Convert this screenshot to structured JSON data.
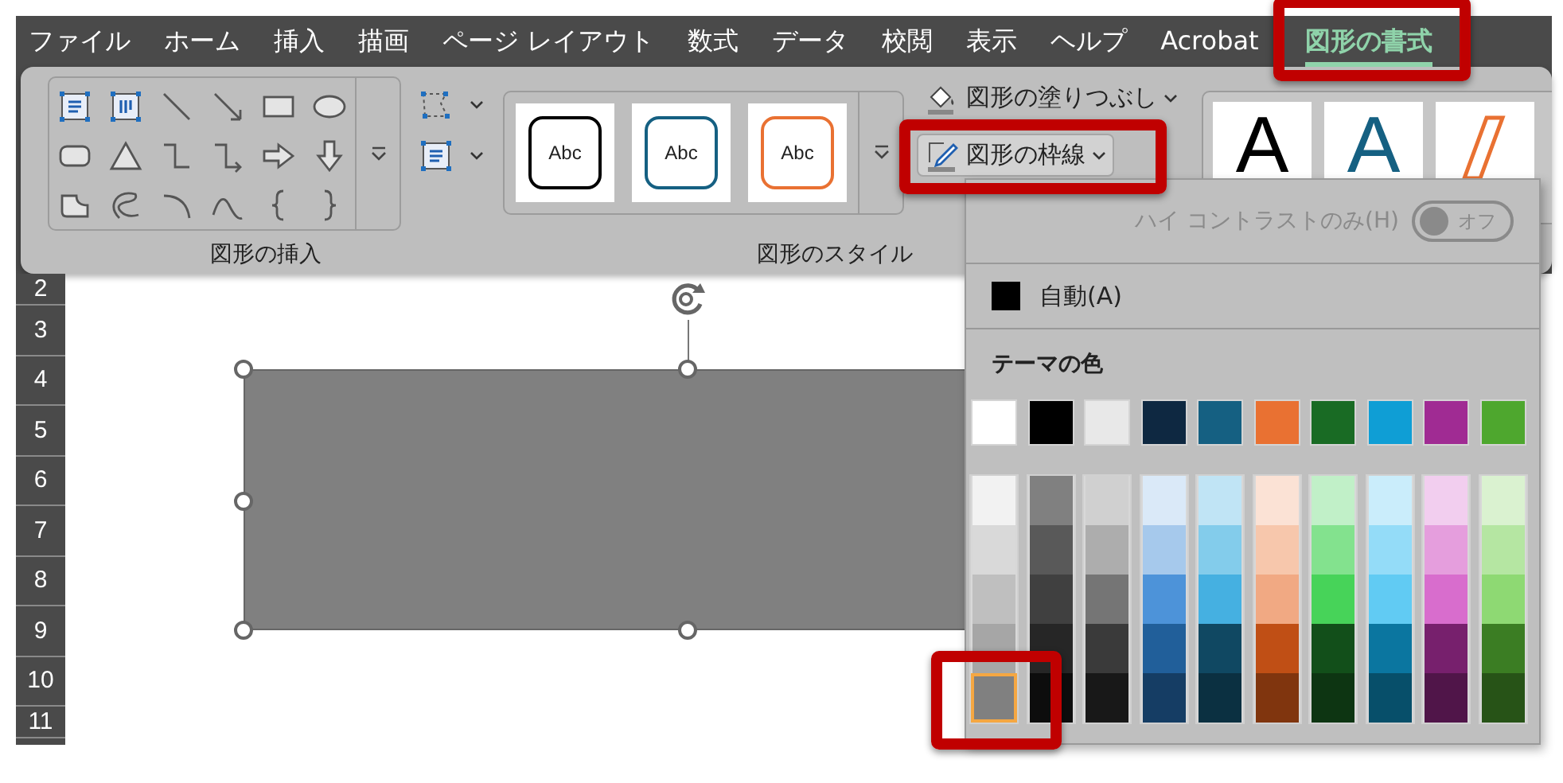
{
  "tabs": [
    {
      "label": "ファイル",
      "selected": false,
      "highlighted": false
    },
    {
      "label": "ホーム",
      "selected": false,
      "highlighted": false
    },
    {
      "label": "挿入",
      "selected": false,
      "highlighted": false
    },
    {
      "label": "描画",
      "selected": false,
      "highlighted": false
    },
    {
      "label": "ページ レイアウト",
      "selected": false,
      "highlighted": false
    },
    {
      "label": "数式",
      "selected": false,
      "highlighted": false
    },
    {
      "label": "データ",
      "selected": false,
      "highlighted": false
    },
    {
      "label": "校閲",
      "selected": false,
      "highlighted": false
    },
    {
      "label": "表示",
      "selected": false,
      "highlighted": false
    },
    {
      "label": "ヘルプ",
      "selected": false,
      "highlighted": false
    },
    {
      "label": "Acrobat",
      "selected": false,
      "highlighted": false
    },
    {
      "label": "図形の書式",
      "selected": true,
      "highlighted": true
    }
  ],
  "ribbon": {
    "insert_group": {
      "label": "図形の挿入"
    },
    "style_group": {
      "label": "図形のスタイル",
      "presets": [
        {
          "text": "Abc",
          "color": "#000000"
        },
        {
          "text": "Abc",
          "color": "#156082"
        },
        {
          "text": "Abc",
          "color": "#e97132"
        }
      ],
      "fill_button": {
        "label": "図形の塗りつぶし"
      },
      "outline_button": {
        "label": "図形の枠線",
        "pressed": true,
        "highlighted": true
      }
    },
    "wordart_presets": [
      {
        "text": "A",
        "kind": "solid",
        "color": "#000000"
      },
      {
        "text": "A",
        "kind": "solid",
        "color": "#156082"
      },
      {
        "kind": "outline",
        "color": "#e97132"
      }
    ]
  },
  "row_headers": [
    "2",
    "3",
    "4",
    "5",
    "6",
    "7",
    "8",
    "9",
    "10",
    "11"
  ],
  "outline_menu": {
    "high_contrast": {
      "label": "ハイ コントラストのみ(H)",
      "disabled": true,
      "toggle": {
        "label": "オフ",
        "on": false
      }
    },
    "automatic": {
      "label": "自動(A)",
      "color": "#000000"
    },
    "theme_colors": {
      "title": "テーマの色",
      "base": [
        {
          "color": "#ffffff",
          "selected": false
        },
        {
          "color": "#000000",
          "selected": false
        },
        {
          "color": "#e8e8e8",
          "selected": false
        },
        {
          "color": "#0e2841",
          "selected": false
        },
        {
          "color": "#156082",
          "selected": false
        },
        {
          "color": "#e97132",
          "selected": false
        },
        {
          "color": "#196b24",
          "selected": false
        },
        {
          "color": "#0f9ed5",
          "selected": false
        },
        {
          "color": "#a02b93",
          "selected": false
        },
        {
          "color": "#4ea72e",
          "selected": false
        }
      ],
      "shade_columns": [
        [
          {
            "color": "#f2f2f2",
            "selected": false,
            "highlighted": false
          },
          {
            "color": "#d9d9d9",
            "selected": false,
            "highlighted": false
          },
          {
            "color": "#bfbfbf",
            "selected": false,
            "highlighted": false
          },
          {
            "color": "#a6a6a6",
            "selected": false,
            "highlighted": false
          },
          {
            "color": "#808080",
            "selected": true,
            "highlighted": true
          }
        ],
        [
          {
            "color": "#808080",
            "selected": false,
            "highlighted": false
          },
          {
            "color": "#595959",
            "selected": false,
            "highlighted": false
          },
          {
            "color": "#404040",
            "selected": false,
            "highlighted": false
          },
          {
            "color": "#262626",
            "selected": false,
            "highlighted": false
          },
          {
            "color": "#0d0d0d",
            "selected": false,
            "highlighted": false
          }
        ],
        [
          {
            "color": "#d0d0d0",
            "selected": false,
            "highlighted": false
          },
          {
            "color": "#adadad",
            "selected": false,
            "highlighted": false
          },
          {
            "color": "#757575",
            "selected": false,
            "highlighted": false
          },
          {
            "color": "#3a3a3a",
            "selected": false,
            "highlighted": false
          },
          {
            "color": "#181818",
            "selected": false,
            "highlighted": false
          }
        ],
        [
          {
            "color": "#dae9f8",
            "selected": false,
            "highlighted": false
          },
          {
            "color": "#a6c9ec",
            "selected": false,
            "highlighted": false
          },
          {
            "color": "#4d93d9",
            "selected": false,
            "highlighted": false
          },
          {
            "color": "#215f9a",
            "selected": false,
            "highlighted": false
          },
          {
            "color": "#153d64",
            "selected": false,
            "highlighted": false
          }
        ],
        [
          {
            "color": "#c0e4f5",
            "selected": false,
            "highlighted": false
          },
          {
            "color": "#83cceb",
            "selected": false,
            "highlighted": false
          },
          {
            "color": "#45b0e1",
            "selected": false,
            "highlighted": false
          },
          {
            "color": "#104862",
            "selected": false,
            "highlighted": false
          },
          {
            "color": "#0b3041",
            "selected": false,
            "highlighted": false
          }
        ],
        [
          {
            "color": "#fbe2d5",
            "selected": false,
            "highlighted": false
          },
          {
            "color": "#f7c7ac",
            "selected": false,
            "highlighted": false
          },
          {
            "color": "#f1a983",
            "selected": false,
            "highlighted": false
          },
          {
            "color": "#c04f15",
            "selected": false,
            "highlighted": false
          },
          {
            "color": "#80350e",
            "selected": false,
            "highlighted": false
          }
        ],
        [
          {
            "color": "#c1f0c8",
            "selected": false,
            "highlighted": false
          },
          {
            "color": "#83e28e",
            "selected": false,
            "highlighted": false
          },
          {
            "color": "#47d359",
            "selected": false,
            "highlighted": false
          },
          {
            "color": "#124f1a",
            "selected": false,
            "highlighted": false
          },
          {
            "color": "#0d3512",
            "selected": false,
            "highlighted": false
          }
        ],
        [
          {
            "color": "#caedfb",
            "selected": false,
            "highlighted": false
          },
          {
            "color": "#94dcf8",
            "selected": false,
            "highlighted": false
          },
          {
            "color": "#61cbf3",
            "selected": false,
            "highlighted": false
          },
          {
            "color": "#0b76a0",
            "selected": false,
            "highlighted": false
          },
          {
            "color": "#074f6a",
            "selected": false,
            "highlighted": false
          }
        ],
        [
          {
            "color": "#f2ceef",
            "selected": false,
            "highlighted": false
          },
          {
            "color": "#e59edd",
            "selected": false,
            "highlighted": false
          },
          {
            "color": "#d86dcd",
            "selected": false,
            "highlighted": false
          },
          {
            "color": "#77206d",
            "selected": false,
            "highlighted": false
          },
          {
            "color": "#501549",
            "selected": false,
            "highlighted": false
          }
        ],
        [
          {
            "color": "#daf2d0",
            "selected": false,
            "highlighted": false
          },
          {
            "color": "#b5e6a2",
            "selected": false,
            "highlighted": false
          },
          {
            "color": "#8ed973",
            "selected": false,
            "highlighted": false
          },
          {
            "color": "#3b7d23",
            "selected": false,
            "highlighted": false
          },
          {
            "color": "#275317",
            "selected": false,
            "highlighted": false
          }
        ]
      ]
    }
  }
}
